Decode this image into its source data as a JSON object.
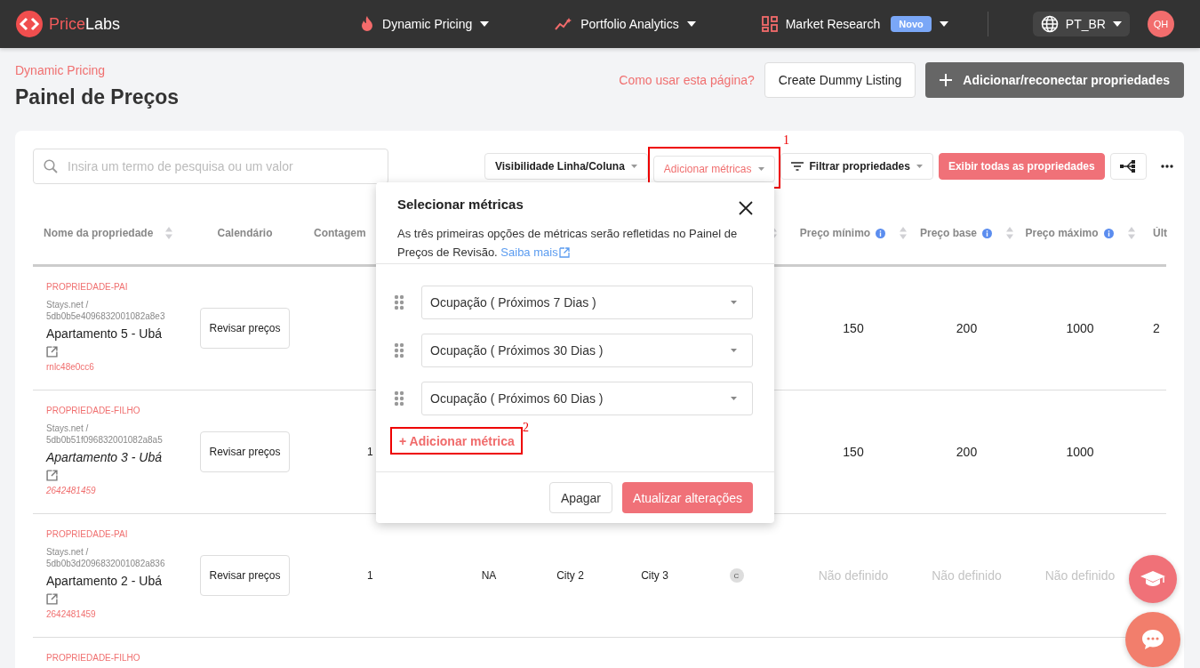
{
  "nav": {
    "logo": {
      "part1": "Price",
      "part2": "Labs"
    },
    "items": [
      {
        "label": "Dynamic Pricing"
      },
      {
        "label": "Portfolio Analytics"
      },
      {
        "label": "Market Research",
        "badge": "Novo"
      }
    ],
    "language": "PT_BR",
    "avatar": "QH"
  },
  "page": {
    "breadcrumb": "Dynamic Pricing",
    "title": "Painel de Preços",
    "help_link": "Como usar esta página?",
    "buttons": [
      {
        "label": "Create Dummy Listing",
        "kind": "secondary"
      },
      {
        "label": "Adicionar/reconectar propriedades",
        "kind": "dark"
      }
    ]
  },
  "toolbar": {
    "search": {
      "placeholder": "Insira um termo de pesquisa ou um valor"
    },
    "buttons": [
      {
        "label": "Visibilidade Linha/Coluna",
        "kind": "dropdown",
        "active": false
      },
      {
        "label": "Adicionar métricas",
        "kind": "dropdown",
        "active": true
      },
      {
        "label": "Filtrar propriedades",
        "kind": "filter"
      },
      {
        "label": "Exibir todas as propriedades",
        "kind": "primary"
      },
      {
        "kind": "tree"
      },
      {
        "kind": "more"
      }
    ]
  },
  "table": {
    "columns": [
      {
        "label": "Nome da propriedade",
        "sortable": true,
        "info": false
      },
      {
        "label": "Calendário",
        "sortable": false,
        "info": false
      },
      {
        "label": "Contagem"
      },
      {
        "sortable": true,
        "info": false
      },
      {
        "label": "Preço mínimo",
        "sortable": true,
        "info": true
      },
      {
        "label": "Preço base",
        "sortable": true,
        "info": true
      },
      {
        "label": "Preço máximo",
        "sortable": true,
        "info": true
      },
      {
        "label": "Últ",
        "sortable": false,
        "info": false
      }
    ],
    "rows": [
      {
        "tag": "PROPRIEDADE-PAI",
        "child": false,
        "source": "Stays.net /",
        "id": "5db0b5e4096832001082a8e3",
        "name": "Apartamento 5 - Ubá",
        "code": "rnlc48e0cc6",
        "button": "Revisar preços",
        "min_price": "150",
        "base_price": "200",
        "max_price": "1000",
        "column_11": "2"
      },
      {
        "tag": "PROPRIEDADE-FILHO",
        "child": true,
        "source": "Stays.net /",
        "id": "5db0b51f096832001082a8a5",
        "name": "Apartamento 3 - Ubá",
        "code": "2642481459",
        "button": "Revisar preços",
        "count": "1",
        "min_price": "150",
        "base_price": "200",
        "max_price": "1000"
      },
      {
        "tag": "PROPRIEDADE-PAI",
        "child": false,
        "source": "Stays.net /",
        "id": "5db0b3d2096832001082a836",
        "name": "Apartamento 2 - Ubá",
        "code": "2642481459",
        "button": "Revisar preços",
        "count": "1",
        "column_4": "NA",
        "column_5": "City 2",
        "column_6": "City 3",
        "column_7": "C",
        "min_price": "Não definido",
        "base_price": "Não definido",
        "max_price": "Não definido"
      },
      {
        "tag": "PROPRIEDADE-FILHO"
      }
    ]
  },
  "popup": {
    "title": "Selecionar métricas",
    "description": "As três primeiras opções de métricas serão refletidas no Painel de Preços de Revisão.",
    "link": "Saiba mais",
    "metrics": [
      "Ocupação ( Próximos 7 Dias )",
      "Ocupação ( Próximos 30 Dias )",
      "Ocupação ( Próximos 60 Dias )"
    ],
    "add_link": "+ Adicionar métrica",
    "buttons": [
      {
        "label": "Apagar",
        "kind": "secondary"
      },
      {
        "label": "Atualizar alterações",
        "kind": "primary"
      }
    ]
  },
  "annotations": [
    {
      "label": "1"
    },
    {
      "label": "2"
    }
  ]
}
